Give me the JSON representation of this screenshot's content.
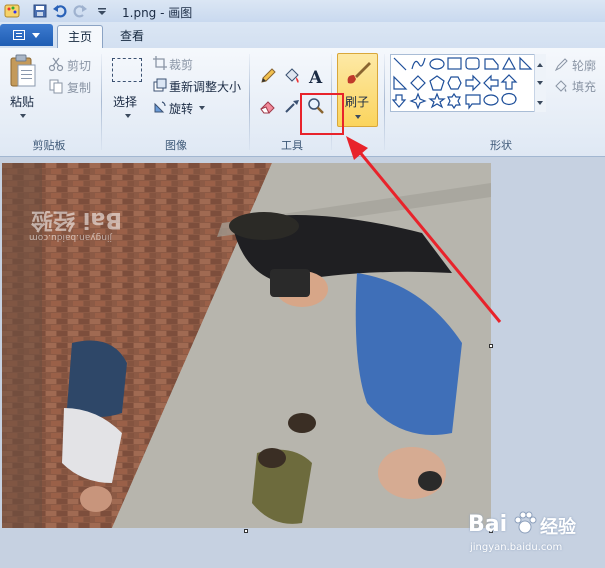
{
  "window": {
    "title": "1.png - 画图"
  },
  "tabs": [
    {
      "label": "主页",
      "active": true
    },
    {
      "label": "查看",
      "active": false
    }
  ],
  "clipboard": {
    "paste_label": "粘贴",
    "cut_label": "剪切",
    "copy_label": "复制",
    "group_label": "剪贴板"
  },
  "image": {
    "select_label": "选择",
    "crop_label": "裁剪",
    "resize_label": "重新调整大小",
    "rotate_label": "旋转",
    "group_label": "图像"
  },
  "tools": {
    "group_label": "工具",
    "items": [
      "pencil-icon",
      "fill-icon",
      "text-icon",
      "eraser-icon",
      "color-picker-icon",
      "magnifier-icon"
    ]
  },
  "brushes": {
    "label": "刷子"
  },
  "shapes": {
    "outline_label": "轮廓",
    "fill_label": "填充",
    "group_label": "形状"
  },
  "colors": {
    "highlight": "#e8232b",
    "arrow": "#e8232b",
    "brush_button": "#fbd45d"
  },
  "photo_watermark": {
    "text": "Bai 经验",
    "url": "jingyan.baidu.com"
  },
  "corner_watermark": {
    "brand": "Bai",
    "suffix": "经验",
    "url": "jingyan.baidu.com"
  }
}
